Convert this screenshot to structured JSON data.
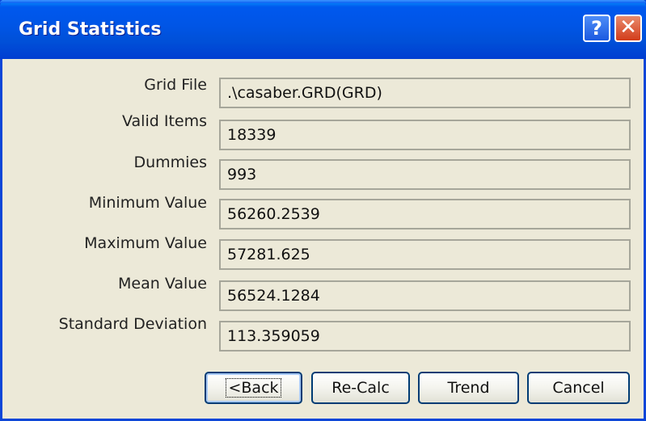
{
  "window": {
    "title": "Grid Statistics",
    "help_glyph": "?",
    "close_glyph": "✕"
  },
  "rows": [
    {
      "label": "Grid File",
      "value": ".\\casaber.GRD(GRD)"
    },
    {
      "label": "Valid Items",
      "value": "18339"
    },
    {
      "label": "Dummies",
      "value": "993"
    },
    {
      "label": "Minimum Value",
      "value": "56260.2539"
    },
    {
      "label": "Maximum Value",
      "value": "57281.625"
    },
    {
      "label": "Mean Value",
      "value": "56524.1284"
    },
    {
      "label": "Standard Deviation",
      "value": "113.359059"
    }
  ],
  "buttons": {
    "back": "<Back",
    "recalc": "Re-Calc",
    "trend": "Trend",
    "cancel": "Cancel"
  }
}
